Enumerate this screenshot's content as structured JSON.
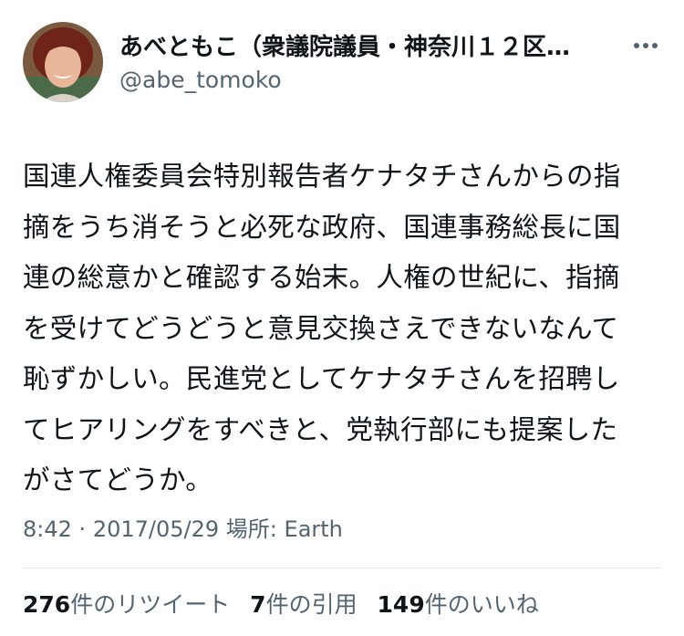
{
  "author": {
    "display_name": "あべともこ（衆議院議員・神奈川１２区…",
    "handle": "@abe_tomoko",
    "avatar": "profile-photo"
  },
  "more_icon": "more-horizontal-icon",
  "tweet": {
    "lines": [
      "国連人権委員会特別報告者ケナタチさんからの指",
      "摘をうち消そうと必死な政府、国連事務総長に国",
      "連の総意かと確認する始末。人権の世紀に、指摘",
      "を受けてどうどうと意見交換さえできないなんて",
      "恥ずかしい。民進党としてケナタチさんを招聘し",
      "てヒアリングをすべきと、党執行部にも提案した",
      "がさてどうか。"
    ]
  },
  "meta": {
    "time": "8:42",
    "separator": "·",
    "date": "2017/05/29",
    "location_label": "場所:",
    "location": "Earth"
  },
  "stats": {
    "retweets_count": "276",
    "retweets_label": "件のリツイート",
    "quotes_count": "7",
    "quotes_label": "件の引用",
    "likes_count": "149",
    "likes_label": "件のいいね"
  },
  "colors": {
    "text_primary": "#0f1419",
    "text_secondary": "#536471",
    "divider": "#e1e8ed"
  }
}
